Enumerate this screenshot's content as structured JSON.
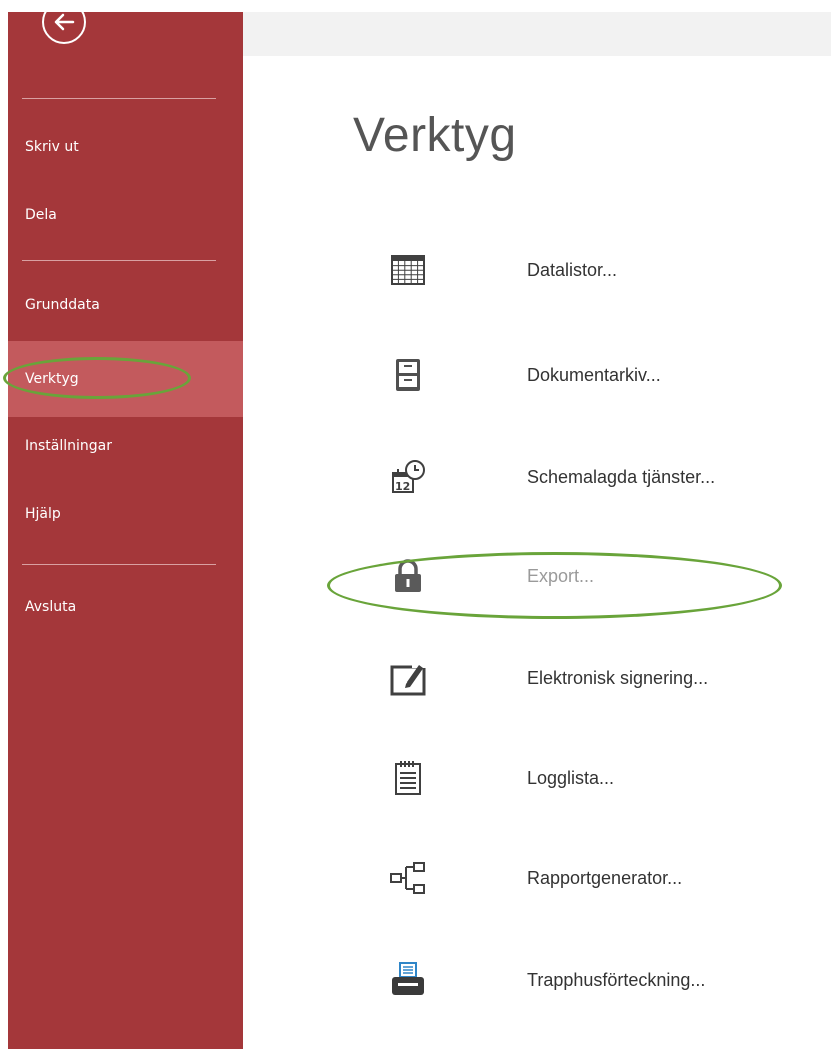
{
  "sidebar": {
    "items": [
      {
        "label": "Skriv ut"
      },
      {
        "label": "Dela"
      },
      {
        "label": "Grunddata"
      },
      {
        "label": "Verktyg",
        "active": true
      },
      {
        "label": "Inställningar"
      },
      {
        "label": "Hjälp"
      },
      {
        "label": "Avsluta"
      }
    ],
    "accent_color": "#a4373a",
    "active_color": "#c35a5d"
  },
  "main": {
    "title": "Verktyg",
    "tools": [
      {
        "label": "Datalistor...",
        "icon": "table-icon"
      },
      {
        "label": "Dokumentarkiv...",
        "icon": "cabinet-icon"
      },
      {
        "label": "Schemalagda tjänster...",
        "icon": "calendar-clock-icon"
      },
      {
        "label": "Export...",
        "icon": "lock-icon",
        "disabled": true
      },
      {
        "label": "Elektronisk signering...",
        "icon": "signature-icon"
      },
      {
        "label": "Logglista...",
        "icon": "notepad-icon"
      },
      {
        "label": "Rapportgenerator...",
        "icon": "hierarchy-icon"
      },
      {
        "label": "Trapphusförteckning...",
        "icon": "printer-icon"
      }
    ]
  },
  "annotation_color": "#69a43a"
}
